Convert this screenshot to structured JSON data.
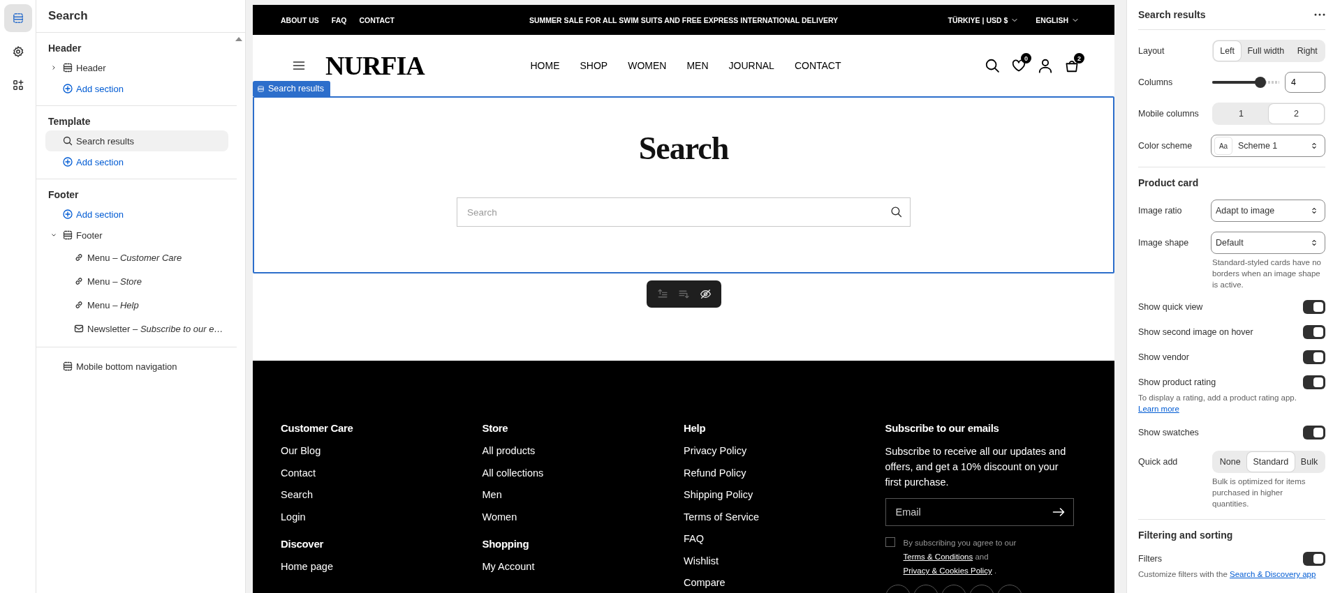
{
  "rail": [
    {
      "selected": true
    },
    {
      "selected": false
    },
    {
      "selected": false
    }
  ],
  "sidebar": {
    "title": "Search",
    "groups": [
      {
        "title": "Header",
        "items": [
          {
            "kind": "header",
            "label": "Header",
            "expanded": false,
            "selected": false
          },
          {
            "kind": "add",
            "label": "Add section",
            "selected": false
          }
        ]
      },
      {
        "title": "Template",
        "items": [
          {
            "kind": "search",
            "label": "Search results",
            "selected": true
          },
          {
            "kind": "add",
            "label": "Add section",
            "selected": false
          }
        ]
      },
      {
        "title": "Footer",
        "items": [
          {
            "kind": "add",
            "label": "Add section",
            "selected": false
          },
          {
            "kind": "footer",
            "label": "Footer",
            "expanded": true,
            "selected": false,
            "children": [
              {
                "kind": "link",
                "label": "Menu – *Customer Care*",
                "selected": false
              },
              {
                "kind": "link",
                "label": "Menu – *Store*",
                "selected": false
              },
              {
                "kind": "link",
                "label": "Menu – *Help*",
                "selected": false
              },
              {
                "kind": "email",
                "label": "Newsletter – *Subscribe to our e…*",
                "selected": false
              }
            ]
          }
        ]
      },
      {
        "items": [
          {
            "kind": "navbar",
            "label": "Mobile bottom navigation",
            "selected": false
          }
        ]
      }
    ]
  },
  "preview": {
    "announcement": {
      "links": [
        "ABOUT US",
        "FAQ",
        "CONTACT"
      ],
      "message": "SUMMER SALE FOR ALL SWIM SUITS AND FREE EXPRESS INTERNATIONAL DELIVERY",
      "selectors": [
        "TÜRKIYE | USD $",
        "ENGLISH"
      ]
    },
    "header": {
      "logo": "NURFIA",
      "nav": [
        "HOME",
        "SHOP",
        "WOMEN",
        "MEN",
        "JOURNAL",
        "CONTACT"
      ],
      "wishlist_count": "0",
      "cart_count": "2"
    },
    "section_label": "Search results",
    "heading": "Search",
    "search": {
      "placeholder": "Search"
    },
    "toolbar": [
      {
        "disabled": true
      },
      {
        "disabled": true
      },
      {
        "disabled": false
      }
    ],
    "footer": {
      "columns": [
        {
          "menus": [
            {
              "title": "Customer Care",
              "links": [
                "Our Blog",
                "Contact",
                "Search",
                "Login"
              ]
            },
            {
              "title": "Discover",
              "links": [
                "Home page"
              ]
            }
          ]
        },
        {
          "menus": [
            {
              "title": "Store",
              "links": [
                "All products",
                "All collections",
                "Men",
                "Women"
              ]
            },
            {
              "title": "Shopping",
              "links": [
                "My Account"
              ]
            }
          ]
        },
        {
          "menus": [
            {
              "title": "Help",
              "links": [
                "Privacy Policy",
                "Refund Policy",
                "Shipping Policy",
                "Terms of Service",
                "FAQ",
                "Wishlist",
                "Compare"
              ]
            }
          ]
        }
      ],
      "newsletter": {
        "title": "Subscribe to our emails",
        "text": "Subscribe to receive all our updates and offers, and get a 10% discount on your first purchase.",
        "email": {
          "placeholder": "Email"
        },
        "consent": {
          "checked": false,
          "before": "By subscribing you agree to our ",
          "terms": "Terms & Conditions",
          "middle": " and ",
          "privacy": "Privacy & Cookies Policy",
          "after": " ."
        }
      }
    }
  },
  "panel": {
    "title": "Search results",
    "sections": [
      {
        "rows": [
          {
            "kind": "segmented",
            "label": "Layout",
            "options": [
              {
                "label": "Left",
                "selected": true
              },
              {
                "label": "Full width",
                "selected": false
              },
              {
                "label": "Right",
                "selected": false
              }
            ]
          },
          {
            "kind": "range",
            "label": "Columns",
            "level": 0.72,
            "value": "4"
          },
          {
            "kind": "segmented",
            "label": "Mobile columns",
            "options": [
              {
                "label": "1",
                "selected": false
              },
              {
                "label": "2",
                "selected": true
              }
            ]
          },
          {
            "kind": "select",
            "label": "Color scheme",
            "swatch": "Aa",
            "value": "Scheme 1"
          }
        ]
      },
      {
        "heading": "Product card",
        "rows": [
          {
            "kind": "select",
            "label": "Image ratio",
            "value": "Adapt to image"
          },
          {
            "kind": "select",
            "label": "Image shape",
            "value": "Default",
            "help": "Standard-styled cards have no borders when an image shape is active."
          },
          {
            "kind": "toggle",
            "label": "Show quick view",
            "on": true
          },
          {
            "kind": "toggle",
            "label": "Show second image on hover",
            "on": true
          },
          {
            "kind": "toggle",
            "label": "Show vendor",
            "on": true
          },
          {
            "kind": "toggle",
            "label": "Show product rating",
            "on": true,
            "help": "To display a rating, add a product rating app.",
            "help_link": "Learn more"
          },
          {
            "kind": "toggle",
            "label": "Show swatches",
            "on": true
          },
          {
            "kind": "segmented",
            "label": "Quick add",
            "options": [
              {
                "label": "None",
                "selected": false
              },
              {
                "label": "Standard",
                "selected": true
              },
              {
                "label": "Bulk",
                "selected": false
              }
            ],
            "help": "Bulk is optimized for items purchased in higher quantities."
          }
        ]
      },
      {
        "heading": "Filtering and sorting",
        "rows": [
          {
            "kind": "toggle",
            "label": "Filters",
            "on": true,
            "help": "Customize filters with the ",
            "help_link": "Search & Discovery app"
          }
        ]
      }
    ]
  }
}
